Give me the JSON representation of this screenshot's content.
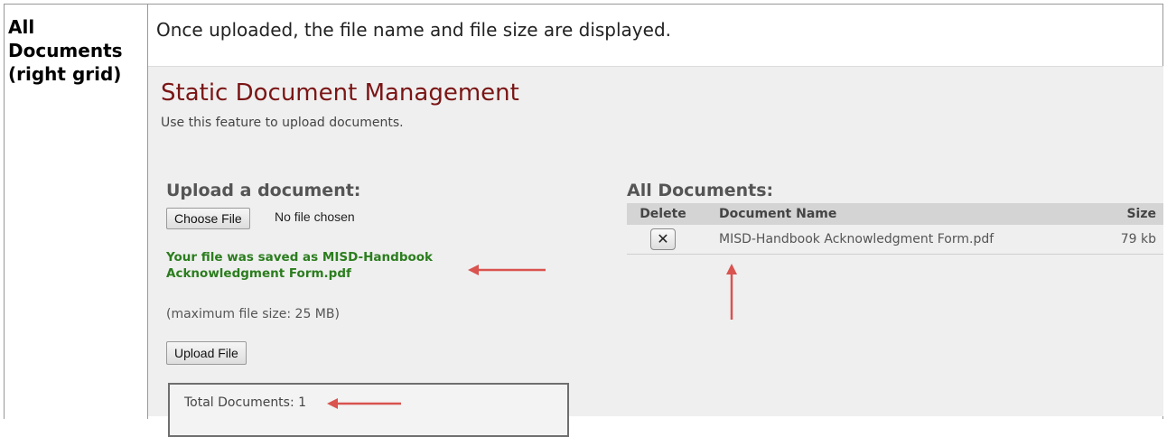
{
  "row_label": "All Documents (right grid)",
  "description": "Once uploaded, the file name and file size are displayed.",
  "screen": {
    "title": "Static Document Management",
    "subtitle": "Use this feature to upload documents.",
    "upload": {
      "heading": "Upload a document:",
      "choose_label": "Choose File",
      "no_file_text": "No file chosen",
      "saved_message": "Your file was saved as MISD-Handbook Acknowledgment Form.pdf",
      "max_size": "(maximum file size: 25 MB)",
      "upload_label": "Upload File"
    },
    "total": "Total Documents: 1",
    "all_documents": {
      "heading": "All Documents:",
      "columns": [
        "Delete",
        "Document Name",
        "Size"
      ],
      "rows": [
        {
          "delete_icon": "close-icon",
          "name": "MISD-Handbook Acknowledgment Form.pdf",
          "size": "79 kb"
        }
      ]
    }
  },
  "colors": {
    "title": "#7b1515",
    "success": "#2b7d1e",
    "annotation_arrow": "#d9534f"
  }
}
